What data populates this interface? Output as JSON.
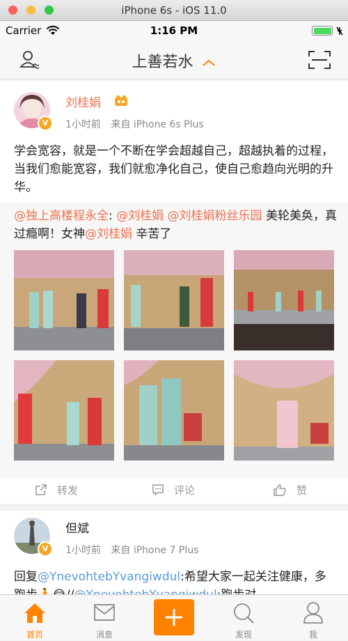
{
  "window": {
    "title": "iPhone 6s - iOS 11.0"
  },
  "status_bar": {
    "carrier": "Carrier",
    "time": "1:16 PM",
    "battery_level": 1.0
  },
  "nav": {
    "title": "上善若水"
  },
  "posts": [
    {
      "author": "刘桂娟",
      "time": "1小时前",
      "source": "来自 iPhone 6s Plus",
      "text": "学会宽容，就是一个不断在学会超越自己，超越执着的过程，当我们愈能宽容，我们就愈净化自己，使自己愈趋向光明的升华。",
      "repost": {
        "m1": "@独上高楼程永全",
        "sep1": ": ",
        "m2": "@刘桂娟",
        "sep2": "  ",
        "m3": "@刘桂娟粉丝乐园",
        "t1": "  美轮美奂，真过瘾啊！女神",
        "m4": "@刘桂娟",
        "t2": "  辛苦了"
      },
      "actions": {
        "repost": "转发",
        "comment": "评论",
        "like": "赞"
      }
    },
    {
      "author": "但斌",
      "time": "1小时前",
      "source": "来自 iPhone 7 Plus",
      "text_prefix": "回复",
      "mention1": "@YnevohtebYvangiwdul",
      "text_mid": ":希望大家一起关注健康，多跑步🏃😂//",
      "mention2": "@YnevohtebYvangiwdul",
      "text_end": ":跑步对"
    }
  ],
  "tabbar": {
    "home": "首页",
    "messages": "消息",
    "discover": "发现",
    "me": "我"
  },
  "colors": {
    "accent": "#ff8200",
    "mention": "#eb7350",
    "link": "#5b9bd5"
  }
}
